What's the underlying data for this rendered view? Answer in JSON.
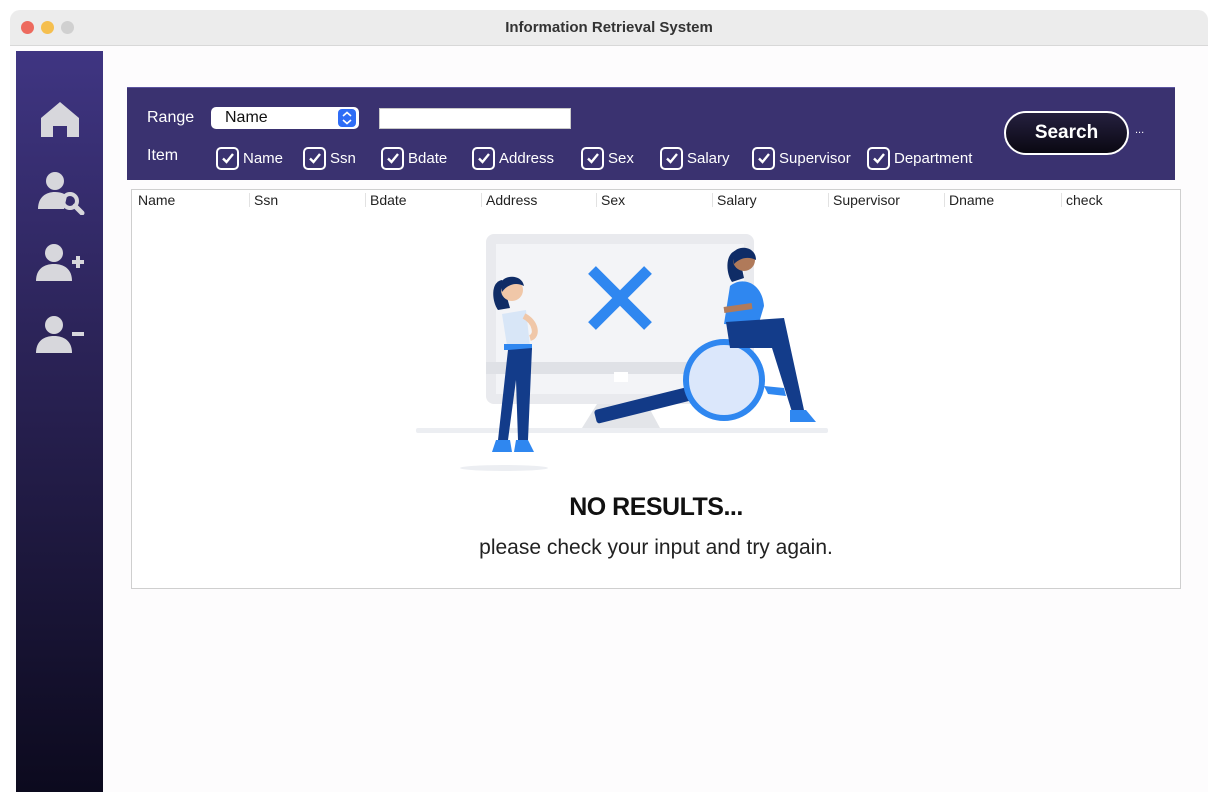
{
  "window": {
    "title": "Information Retrieval System"
  },
  "sidebar": {
    "items": [
      {
        "icon": "home-icon"
      },
      {
        "icon": "search-user-icon"
      },
      {
        "icon": "add-user-icon"
      },
      {
        "icon": "remove-user-icon"
      }
    ]
  },
  "toolbar": {
    "range_label": "Range",
    "range_value": "Name",
    "search_value": "",
    "item_label": "Item",
    "checkboxes": [
      {
        "label": "Name",
        "checked": true
      },
      {
        "label": "Ssn",
        "checked": true
      },
      {
        "label": "Bdate",
        "checked": true
      },
      {
        "label": "Address",
        "checked": true
      },
      {
        "label": "Sex",
        "checked": true
      },
      {
        "label": "Salary",
        "checked": true
      },
      {
        "label": "Supervisor",
        "checked": true
      },
      {
        "label": "Department",
        "checked": true
      }
    ],
    "search_label": "Search",
    "overflow": "..."
  },
  "table": {
    "columns": [
      "Name",
      "Ssn",
      "Bdate",
      "Address",
      "Sex",
      "Salary",
      "Supervisor",
      "Dname",
      "check"
    ]
  },
  "empty_state": {
    "title": "NO RESULTS...",
    "subtitle": "please check your input and try again."
  },
  "colors": {
    "sidebar_top": "#3f3582",
    "toolbar": "#3a3270",
    "accent_blue": "#2f6df6"
  }
}
